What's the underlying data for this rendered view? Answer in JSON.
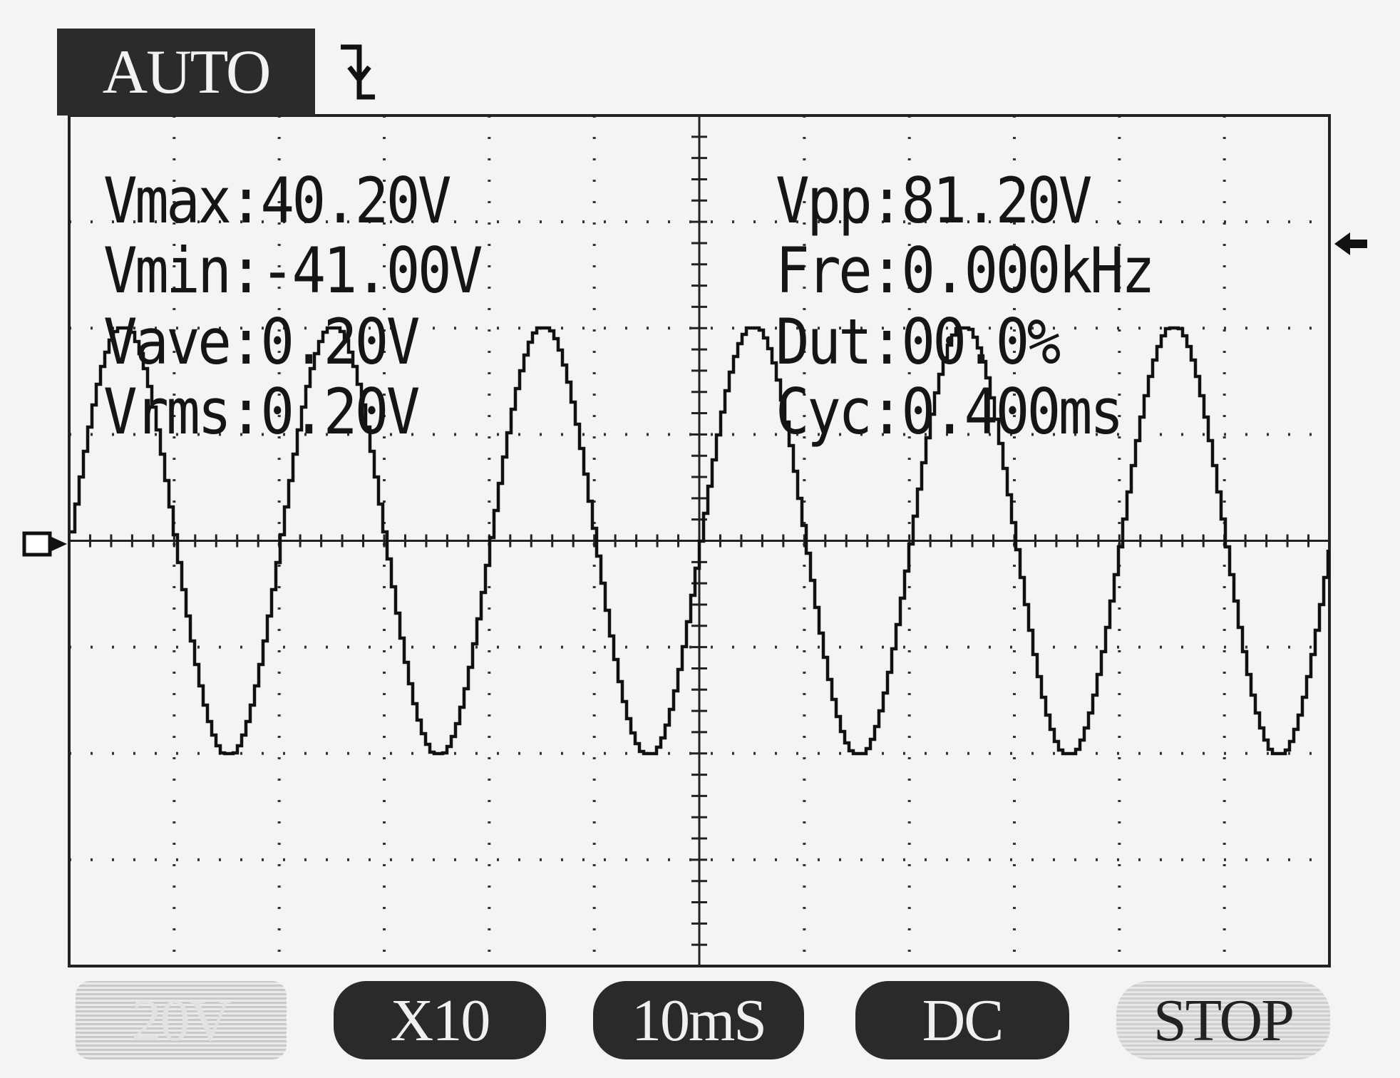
{
  "header": {
    "mode": "AUTO",
    "trigger_icon": "falling-edge-trigger-icon"
  },
  "measurements": {
    "vmax": "Vmax:40.20V",
    "vmin": "Vmin:-41.00V",
    "vave": "Vave:0.20V",
    "vrms": "Vrms:0.20V",
    "vpp": "Vpp:81.20V",
    "fre": "Fre:0.000kHz",
    "dut": "Dut:00.0%",
    "cyc": "Cyc:0.400ms"
  },
  "softkeys": {
    "volts_div": "20V",
    "probe": "X10",
    "timebase": "10mS",
    "coupling": "DC",
    "run_state": "STOP"
  },
  "markers": {
    "channel_marker": "ground-level-marker-icon",
    "trigger_level_marker": "trigger-level-arrow-icon"
  },
  "chart_data": {
    "type": "line",
    "title": "",
    "xlabel": "",
    "ylabel": "",
    "grid": true,
    "grid_divisions": {
      "x": 12,
      "y": 8
    },
    "volts_per_div": 20,
    "ylim": [
      -80,
      80
    ],
    "series": [
      {
        "shape": "sine",
        "amplitude_v": 40.6,
        "offset_v": 0,
        "cycles_on_screen": 6.0,
        "start_phase_deg": 180
      }
    ]
  },
  "colors": {
    "background": "#f4f4f4",
    "trace": "#111111",
    "grid": "#222222",
    "badge_bg": "#2b2b2b"
  }
}
